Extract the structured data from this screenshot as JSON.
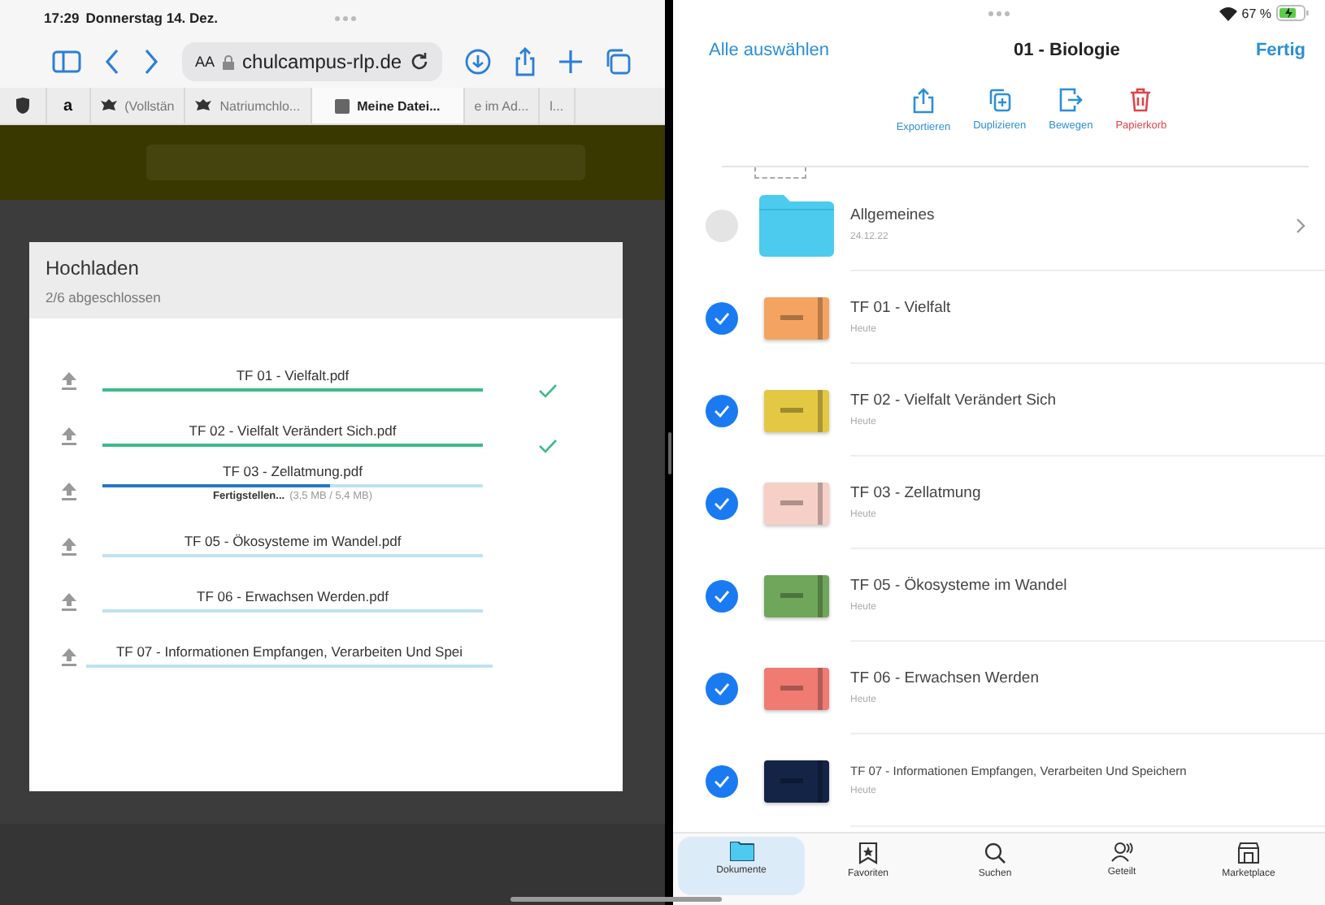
{
  "left": {
    "status_bar": {
      "time": "17:29",
      "date": "Donnerstag 14. Dez."
    },
    "browser": {
      "text_size_button": "AA",
      "url": "chulcampus-rlp.de"
    },
    "tabs": [
      {
        "selected": false
      },
      {
        "label": "a",
        "selected": false
      },
      {
        "label": "(Vollstän",
        "selected": false
      },
      {
        "label": "Natriumchlo...",
        "selected": false
      },
      {
        "label": "Meine Datei...",
        "selected": true
      },
      {
        "label": "e im Ad...",
        "selected": false
      },
      {
        "label": "l...",
        "selected": false
      }
    ],
    "upload_dialog": {
      "title": "Hochladen",
      "subtitle": "2/6 abgeschlossen",
      "files": [
        {
          "name": "TF 01 - Vielfalt.pdf",
          "level": 1,
          "done": true
        },
        {
          "name": "TF 02 - Vielfalt Verändert Sich.pdf",
          "level": 1,
          "done": true
        },
        {
          "name": "TF 03 - Zellatmung.pdf",
          "level": 0.6,
          "done": false,
          "status": "Fertigstellen...",
          "size": "(3,5 MB / 5,4 MB)"
        },
        {
          "name": "TF 05 - Ökosysteme im Wandel.pdf",
          "level": 0,
          "done": false
        },
        {
          "name": "TF 06 - Erwachsen Werden.pdf",
          "level": 0,
          "done": false
        },
        {
          "name": "TF 07 - Informationen Empfangen, Verarbeiten Und Spei",
          "level": 0,
          "done": false
        }
      ]
    }
  },
  "right": {
    "status_bar": {
      "battery": "67 %"
    },
    "nav": {
      "select_all": "Alle auswählen",
      "title": "01 - Biologie",
      "done": "Fertig"
    },
    "actions": [
      {
        "kind": "export",
        "label": "Exportieren"
      },
      {
        "kind": "duplicate",
        "label": "Duplizieren"
      },
      {
        "kind": "move",
        "label": "Bewegen"
      },
      {
        "kind": "delete",
        "label": "Papierkorb"
      }
    ],
    "items": [
      {
        "kind": "folder",
        "name": "Allgemeines",
        "date": "24.12.22",
        "selected": false
      },
      {
        "kind": "notebook",
        "name": "TF 01 - Vielfalt",
        "date": "Heute",
        "selected": true,
        "color": "#f4a460"
      },
      {
        "kind": "notebook",
        "name": "TF 02 - Vielfalt Verändert Sich",
        "date": "Heute",
        "selected": true,
        "color": "#e3c843"
      },
      {
        "kind": "notebook",
        "name": "TF 03 - Zellatmung",
        "date": "Heute",
        "selected": true,
        "color": "#f6cfc6"
      },
      {
        "kind": "notebook",
        "name": "TF 05 - Ökosysteme im Wandel",
        "date": "Heute",
        "selected": true,
        "color": "#6fa65a"
      },
      {
        "kind": "notebook",
        "name": "TF 06 - Erwachsen Werden",
        "date": "Heute",
        "selected": true,
        "color": "#ef7b73"
      },
      {
        "kind": "notebook",
        "name": "TF 07 - Informationen Empfangen, Verarbeiten Und Speichern",
        "date": "Heute",
        "selected": true,
        "color": "#142447"
      }
    ],
    "tab_bar": [
      {
        "kind": "documents",
        "label": "Dokumente",
        "selected": true
      },
      {
        "kind": "favorites",
        "label": "Favoriten",
        "selected": false
      },
      {
        "kind": "search",
        "label": "Suchen",
        "selected": false
      },
      {
        "kind": "shared",
        "label": "Geteilt",
        "selected": false
      },
      {
        "kind": "marketplace",
        "label": "Marketplace",
        "selected": false
      }
    ]
  }
}
